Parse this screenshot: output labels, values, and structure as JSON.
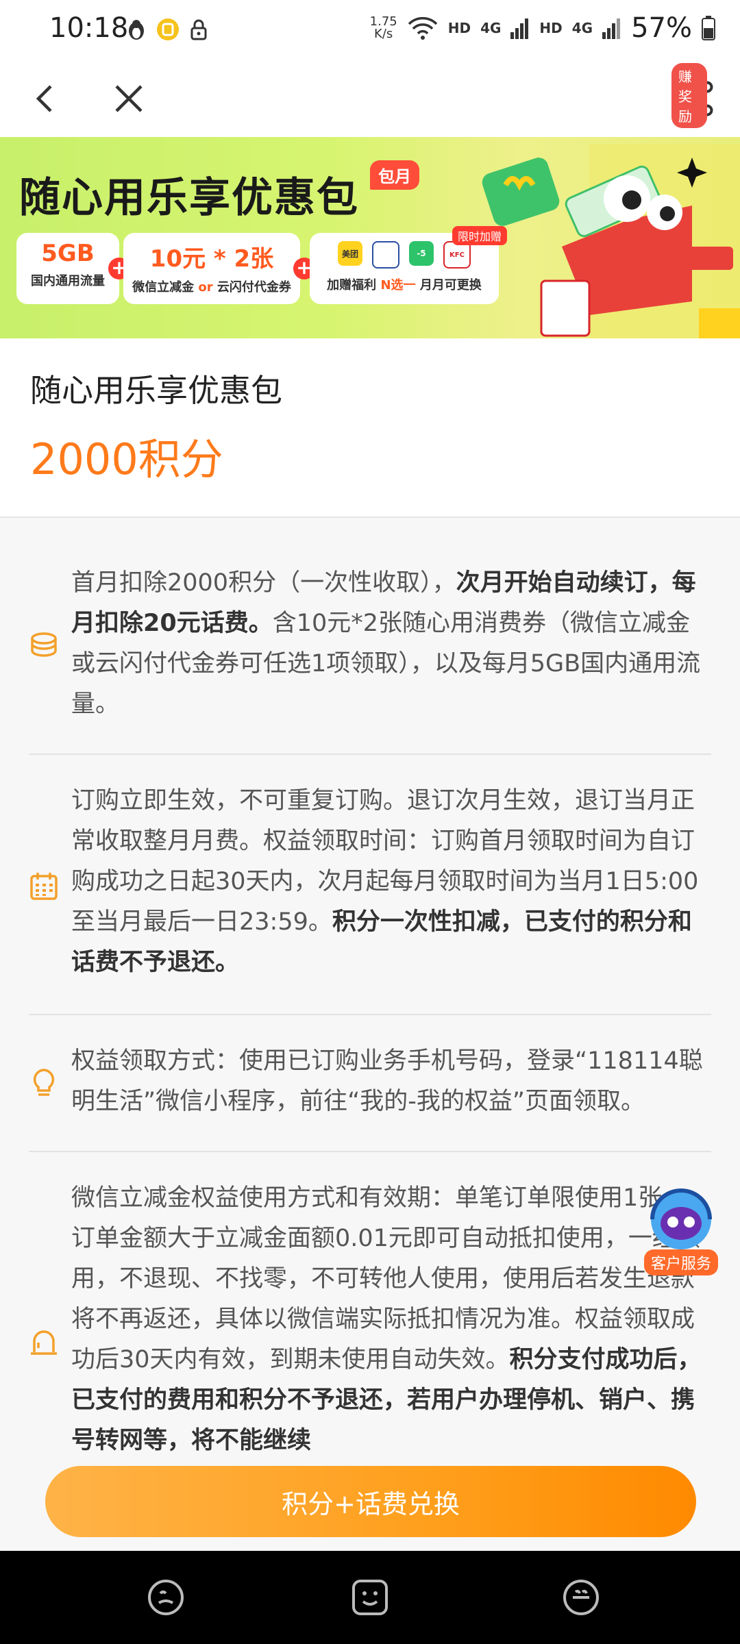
{
  "status_bar": {
    "time": "10:18",
    "net_speed_value": "1.75",
    "net_speed_unit": "K/s",
    "hd1": "HD",
    "hd2": "HD",
    "g4_1": "4G",
    "g4_2": "4G",
    "battery": "57%"
  },
  "nav": {
    "reward_badge": "赚奖励"
  },
  "banner": {
    "title": "随心用乐享优惠包",
    "tag": "包月",
    "card1_big": "5GB",
    "card1_small": "国内通用流量",
    "card2_big": "10元 * 2张",
    "card2_small_a": "微信立减金",
    "card2_or": "or",
    "card2_small_b": "云闪付代金券",
    "card3_limited": "限时加赠",
    "card3_small_a": "加赠福利",
    "card3_n": "N选一",
    "card3_small_b": "月月可更换",
    "brands": [
      "美团",
      "",
      "-5",
      "KFC"
    ]
  },
  "product": {
    "title": "随心用乐享优惠包",
    "price": "2000积分"
  },
  "info": [
    {
      "icon": "coins-icon",
      "parts": [
        {
          "t": "首月扣除2000积分（一次性收取），",
          "b": false
        },
        {
          "t": "次月开始自动续订，每月扣除20元话费。",
          "b": true
        },
        {
          "t": "含10元*2张随心用消费券（微信立减金或云闪付代金券可任选1项领取），以及每月5GB国内通用流量。",
          "b": false
        }
      ]
    },
    {
      "icon": "calendar-icon",
      "parts": [
        {
          "t": "订购立即生效，不可重复订购。退订次月生效，退订当月正常收取整月月费。权益领取时间：订购首月领取时间为自订购成功之日起30天内，次月起每月领取时间为当月1日5:00至当月最后一日23:59。",
          "b": false
        },
        {
          "t": "积分一次性扣减，已支付的积分和话费不予退还。",
          "b": true
        }
      ]
    },
    {
      "icon": "lightbulb-icon",
      "parts": [
        {
          "t": "权益领取方式：使用已订购业务手机号码，登录“118114聪明生活”微信小程序，前往“我的-我的权益”页面领取。",
          "b": false
        }
      ]
    },
    {
      "icon": "bell-icon",
      "parts": [
        {
          "t": "微信立减金权益使用方式和有效期：单笔订单限使用1张，订单金额大于立减金面额0.01元即可自动抵扣使用，一经领用，不退现、不找零，不可转他人使用，使用后若发生退款将不再返还，具体以微信端实际抵扣情况为准。权益领取成功后30天内有效，到期未使用自动失效。",
          "b": false
        },
        {
          "t": "积分支付成功后，已支付的费用和积分不予退还，若用户办理停机、销户、携号转网等，将不能继续",
          "b": true
        }
      ]
    }
  ],
  "service": {
    "label": "客户服务"
  },
  "exchange_button": "积分+话费兑换",
  "colors": {
    "accent": "#ff7a1a",
    "button": "#ff9f1c",
    "banner": "#d7f470"
  }
}
